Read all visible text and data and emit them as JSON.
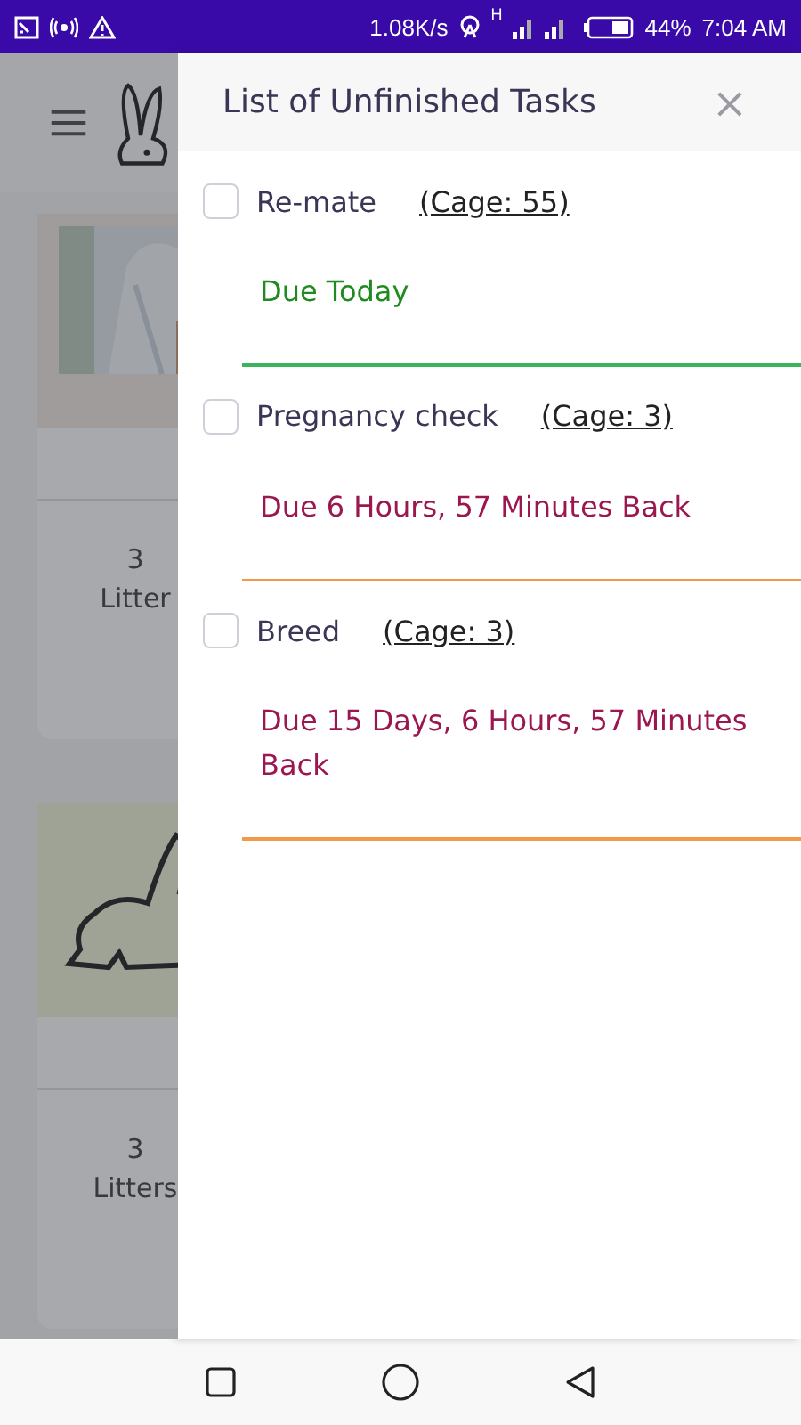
{
  "status_bar": {
    "speed": "1.08K/s",
    "network_type": "H",
    "battery": "44%",
    "time": "7:04 AM"
  },
  "background_app": {
    "cards": [
      {
        "count": "3",
        "label": "Litter"
      },
      {
        "kind": "rabbit",
        "count": "3",
        "label": "Litters"
      }
    ]
  },
  "drawer": {
    "title": "List of Unfinished Tasks",
    "close": "×",
    "tasks": [
      {
        "name": "Re-mate",
        "cage": "(Cage: 55)",
        "due": "Due Today",
        "kind": "today",
        "checked": false
      },
      {
        "name": "Pregnancy check",
        "cage": "(Cage: 3)",
        "due": "Due 6 Hours, 57 Minutes Back",
        "kind": "overdue",
        "checked": false
      },
      {
        "name": "Breed",
        "cage": "(Cage: 3)",
        "due": "Due 15 Days, 6 Hours, 57 Minutes Back",
        "kind": "overdue",
        "checked": false
      }
    ]
  }
}
